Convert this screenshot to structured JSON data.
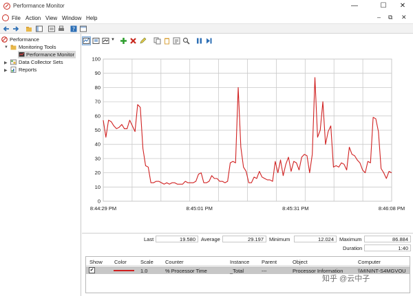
{
  "window": {
    "title": "Performance Monitor",
    "minimize_glyph": "—",
    "maximize_glyph": "☐",
    "close_glyph": "✕"
  },
  "menu": {
    "items": [
      "File",
      "Action",
      "View",
      "Window",
      "Help"
    ],
    "right_min": "–",
    "right_restore": "⧉",
    "right_close": "✕"
  },
  "tree": {
    "root": "Performance",
    "monitoring_tools": "Monitoring Tools",
    "performance_monitor": "Performance Monitor",
    "data_collector_sets": "Data Collector Sets",
    "reports": "Reports"
  },
  "colors": {
    "series": "#d02020",
    "grid": "#c9c9c9",
    "selection": "#d9d9d9",
    "add": "#2e9e2e",
    "delete": "#c8281e",
    "pause": "#2d6fb5"
  },
  "stats": {
    "last_label": "Last",
    "last_value": "19.580",
    "average_label": "Average",
    "average_value": "29.197",
    "minimum_label": "Minimum",
    "minimum_value": "12.024",
    "maximum_label": "Maximum",
    "maximum_value": "86.884",
    "duration_label": "Duration",
    "duration_value": "1:40"
  },
  "legend": {
    "headers": {
      "show": "Show",
      "color": "Color",
      "scale": "Scale",
      "counter": "Counter",
      "instance": "Instance",
      "parent": "Parent",
      "object": "Object",
      "computer": "Computer"
    },
    "rows": [
      {
        "show": "✔",
        "scale": "1.0",
        "counter": "% Processor Time",
        "instance": "_Total",
        "parent": "---",
        "object": "Processor Information",
        "computer": "\\\\MININT-S4MGVOU"
      }
    ]
  },
  "watermark": "知乎 @云中子",
  "chart_data": {
    "type": "line",
    "ylim": [
      0,
      100
    ],
    "yticks": [
      0,
      10,
      20,
      30,
      40,
      50,
      60,
      70,
      80,
      90,
      100
    ],
    "xtick_labels": [
      "8:44:29 PM",
      "8:45:01 PM",
      "8:45:31 PM",
      "8:46:08 PM"
    ],
    "grid": true,
    "series": [
      {
        "color": "#d02020",
        "values": [
          57,
          45,
          57,
          56,
          53,
          51,
          52,
          54,
          51,
          51,
          57,
          53,
          49,
          68,
          66,
          37,
          25,
          24,
          13,
          13,
          14,
          14,
          13,
          12,
          13,
          12,
          13,
          13,
          12,
          12,
          12,
          14,
          13,
          13,
          13,
          14,
          19,
          20,
          13,
          13,
          14,
          18,
          16,
          16,
          14,
          14,
          13,
          14,
          27,
          28,
          27,
          80,
          38,
          24,
          21,
          13,
          13,
          17,
          16,
          21,
          17,
          16,
          15,
          15,
          14,
          28,
          20,
          29,
          18,
          26,
          31,
          21,
          28,
          27,
          22,
          31,
          33,
          32,
          20,
          33,
          87,
          45,
          50,
          70,
          40,
          49,
          53,
          24,
          25,
          24,
          27,
          26,
          22,
          38,
          33,
          32,
          29,
          27,
          22,
          20,
          28,
          27,
          59,
          58,
          49,
          23,
          20,
          16,
          21,
          20
        ]
      }
    ]
  }
}
